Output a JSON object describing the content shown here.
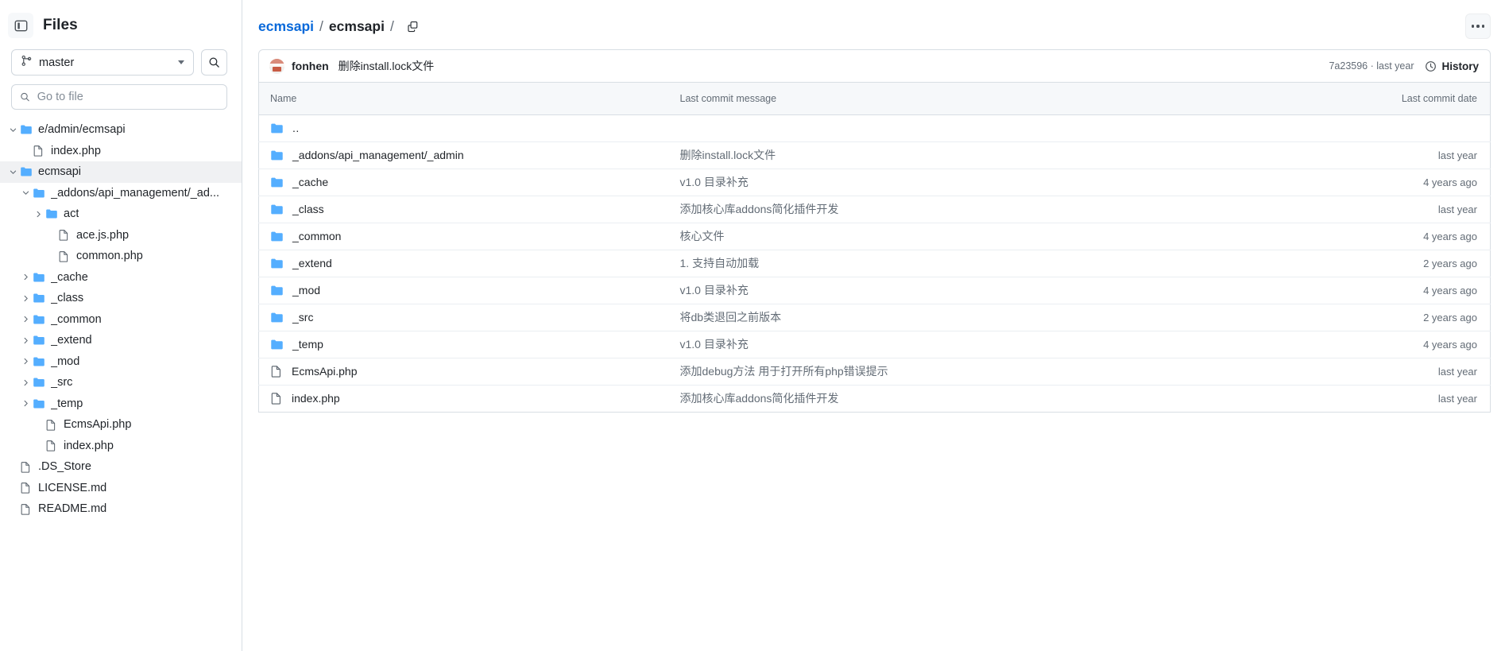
{
  "sidebar": {
    "panel_toggle_icon": "sidebar-panel-icon",
    "title": "Files",
    "branch": {
      "icon": "branch-icon",
      "name": "master",
      "caret_icon": "chevron-down-icon"
    },
    "search_icon": "search-icon",
    "goto_file": {
      "icon": "search-icon",
      "placeholder": "Go to file",
      "value": ""
    },
    "tree": [
      {
        "label": "e/admin/ecmsapi",
        "type": "folder",
        "indent": 0,
        "twisty": "chevron-down",
        "selected": false
      },
      {
        "label": "index.php",
        "type": "file",
        "indent": 1,
        "twisty": "none",
        "selected": false
      },
      {
        "label": "ecmsapi",
        "type": "folder",
        "indent": 0,
        "twisty": "chevron-down",
        "selected": true
      },
      {
        "label": "_addons/api_management/_ad...",
        "type": "folder",
        "indent": 1,
        "twisty": "chevron-down",
        "selected": false
      },
      {
        "label": "act",
        "type": "folder",
        "indent": 2,
        "twisty": "chevron-right",
        "selected": false
      },
      {
        "label": "ace.js.php",
        "type": "file",
        "indent": 3,
        "twisty": "none",
        "selected": false
      },
      {
        "label": "common.php",
        "type": "file",
        "indent": 3,
        "twisty": "none",
        "selected": false
      },
      {
        "label": "_cache",
        "type": "folder",
        "indent": 1,
        "twisty": "chevron-right",
        "selected": false
      },
      {
        "label": "_class",
        "type": "folder",
        "indent": 1,
        "twisty": "chevron-right",
        "selected": false
      },
      {
        "label": "_common",
        "type": "folder",
        "indent": 1,
        "twisty": "chevron-right",
        "selected": false
      },
      {
        "label": "_extend",
        "type": "folder",
        "indent": 1,
        "twisty": "chevron-right",
        "selected": false
      },
      {
        "label": "_mod",
        "type": "folder",
        "indent": 1,
        "twisty": "chevron-right",
        "selected": false
      },
      {
        "label": "_src",
        "type": "folder",
        "indent": 1,
        "twisty": "chevron-right",
        "selected": false
      },
      {
        "label": "_temp",
        "type": "folder",
        "indent": 1,
        "twisty": "chevron-right",
        "selected": false
      },
      {
        "label": "EcmsApi.php",
        "type": "file",
        "indent": 2,
        "twisty": "none",
        "selected": false
      },
      {
        "label": "index.php",
        "type": "file",
        "indent": 2,
        "twisty": "none",
        "selected": false
      },
      {
        "label": ".DS_Store",
        "type": "file",
        "indent": 0,
        "twisty": "none",
        "selected": false
      },
      {
        "label": "LICENSE.md",
        "type": "file",
        "indent": 0,
        "twisty": "none",
        "selected": false
      },
      {
        "label": "README.md",
        "type": "file",
        "indent": 0,
        "twisty": "none",
        "selected": false
      }
    ]
  },
  "header": {
    "breadcrumb": {
      "repo": "ecmsapi",
      "sep1": "/",
      "path": "ecmsapi",
      "sep2": "/"
    },
    "copy_icon": "copy-path-icon",
    "kebab_icon": "more-options-icon"
  },
  "commit_bar": {
    "avatar_icon": "user-avatar",
    "author": "fonhen",
    "message": "删除install.lock文件",
    "meta": "7a23596 · last year",
    "history_icon": "history-clock-icon",
    "history_label": "History"
  },
  "table": {
    "columns": [
      "Name",
      "Last commit message",
      "Last commit date"
    ],
    "rows": [
      {
        "name": "..",
        "type": "folder-up",
        "message": "",
        "date": ""
      },
      {
        "name": "_addons/api_management/_admin",
        "type": "folder",
        "message": "删除install.lock文件",
        "date": "last year"
      },
      {
        "name": "_cache",
        "type": "folder",
        "message": "v1.0 目录补充",
        "date": "4 years ago"
      },
      {
        "name": "_class",
        "type": "folder",
        "message": "添加核心库addons简化插件开发",
        "date": "last year"
      },
      {
        "name": "_common",
        "type": "folder",
        "message": "核心文件",
        "date": "4 years ago"
      },
      {
        "name": "_extend",
        "type": "folder",
        "message": "1. 支持自动加载",
        "date": "2 years ago"
      },
      {
        "name": "_mod",
        "type": "folder",
        "message": "v1.0 目录补充",
        "date": "4 years ago"
      },
      {
        "name": "_src",
        "type": "folder",
        "message": "将db类退回之前版本",
        "date": "2 years ago"
      },
      {
        "name": "_temp",
        "type": "folder",
        "message": "v1.0 目录补充",
        "date": "4 years ago"
      },
      {
        "name": "EcmsApi.php",
        "type": "file",
        "message": "添加debug方法 用于打开所有php错误提示",
        "date": "last year"
      },
      {
        "name": "index.php",
        "type": "file",
        "message": "添加核心库addons简化插件开发",
        "date": "last year"
      }
    ]
  },
  "colors": {
    "link": "#0969da",
    "folder": "#54aeff",
    "border": "#d8dee4",
    "muted": "#636c76"
  }
}
